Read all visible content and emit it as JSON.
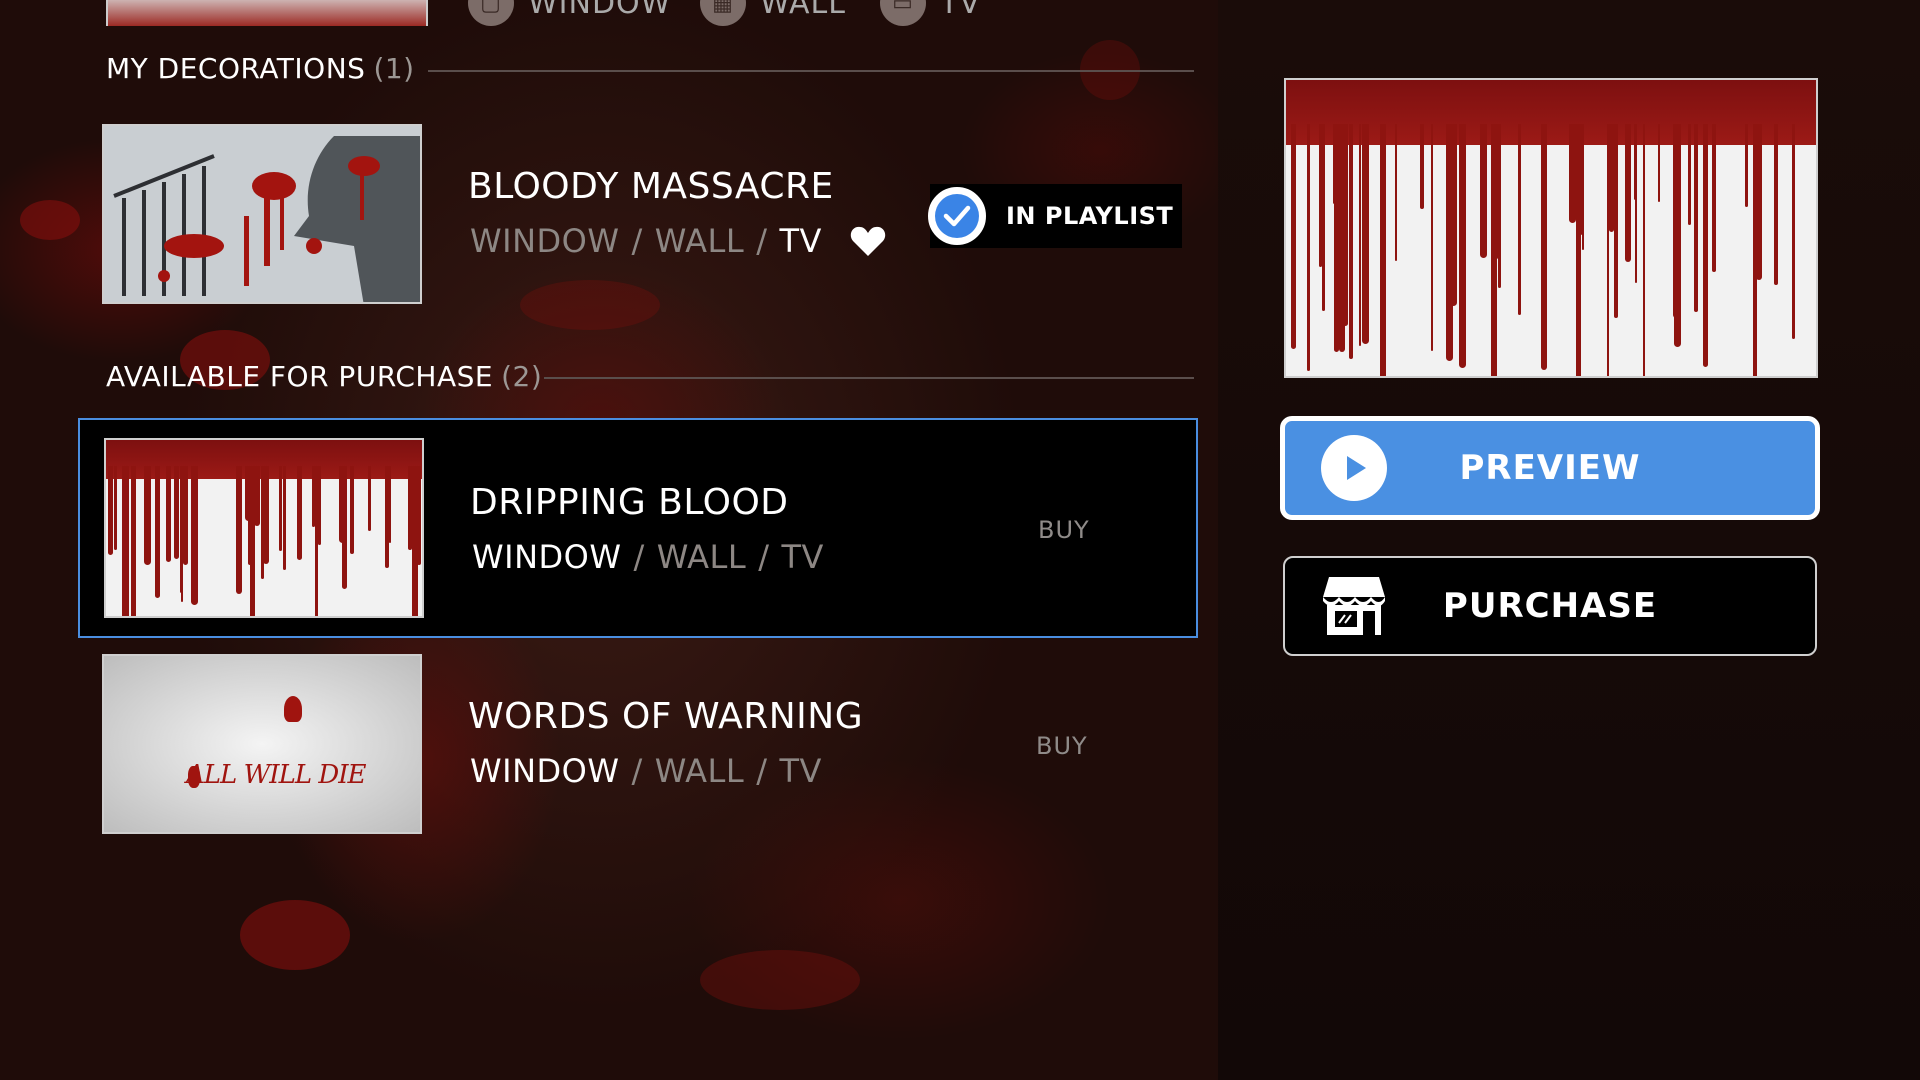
{
  "filters": [
    {
      "label": "WINDOW",
      "icon": "window-icon"
    },
    {
      "label": "WALL",
      "icon": "wall-icon"
    },
    {
      "label": "TV",
      "icon": "tv-icon"
    }
  ],
  "my_decorations": {
    "heading": "MY DECORATIONS",
    "count": "(1)",
    "items": [
      {
        "title": "BLOODY MASSACRE",
        "type_window": "WINDOW",
        "type_wall": "WALL",
        "type_tv": "TV",
        "separator": "/",
        "badge": "IN PLAYLIST"
      }
    ]
  },
  "available": {
    "heading": "AVAILABLE FOR PURCHASE",
    "count": "(2)",
    "items": [
      {
        "title": "DRIPPING BLOOD",
        "type_window": "WINDOW",
        "type_wall": "WALL",
        "type_tv": "TV",
        "separator": "/",
        "action": "BUY"
      },
      {
        "title": "WORDS OF WARNING",
        "type_window": "WINDOW",
        "type_wall": "WALL",
        "type_tv": "TV",
        "separator": "/",
        "action": "BUY",
        "thumb_text": "ALL WILL DIE"
      }
    ]
  },
  "detail": {
    "preview_label": "PREVIEW",
    "purchase_label": "PURCHASE"
  },
  "colors": {
    "accent": "#4a90e2",
    "blood": "#8e1410"
  }
}
